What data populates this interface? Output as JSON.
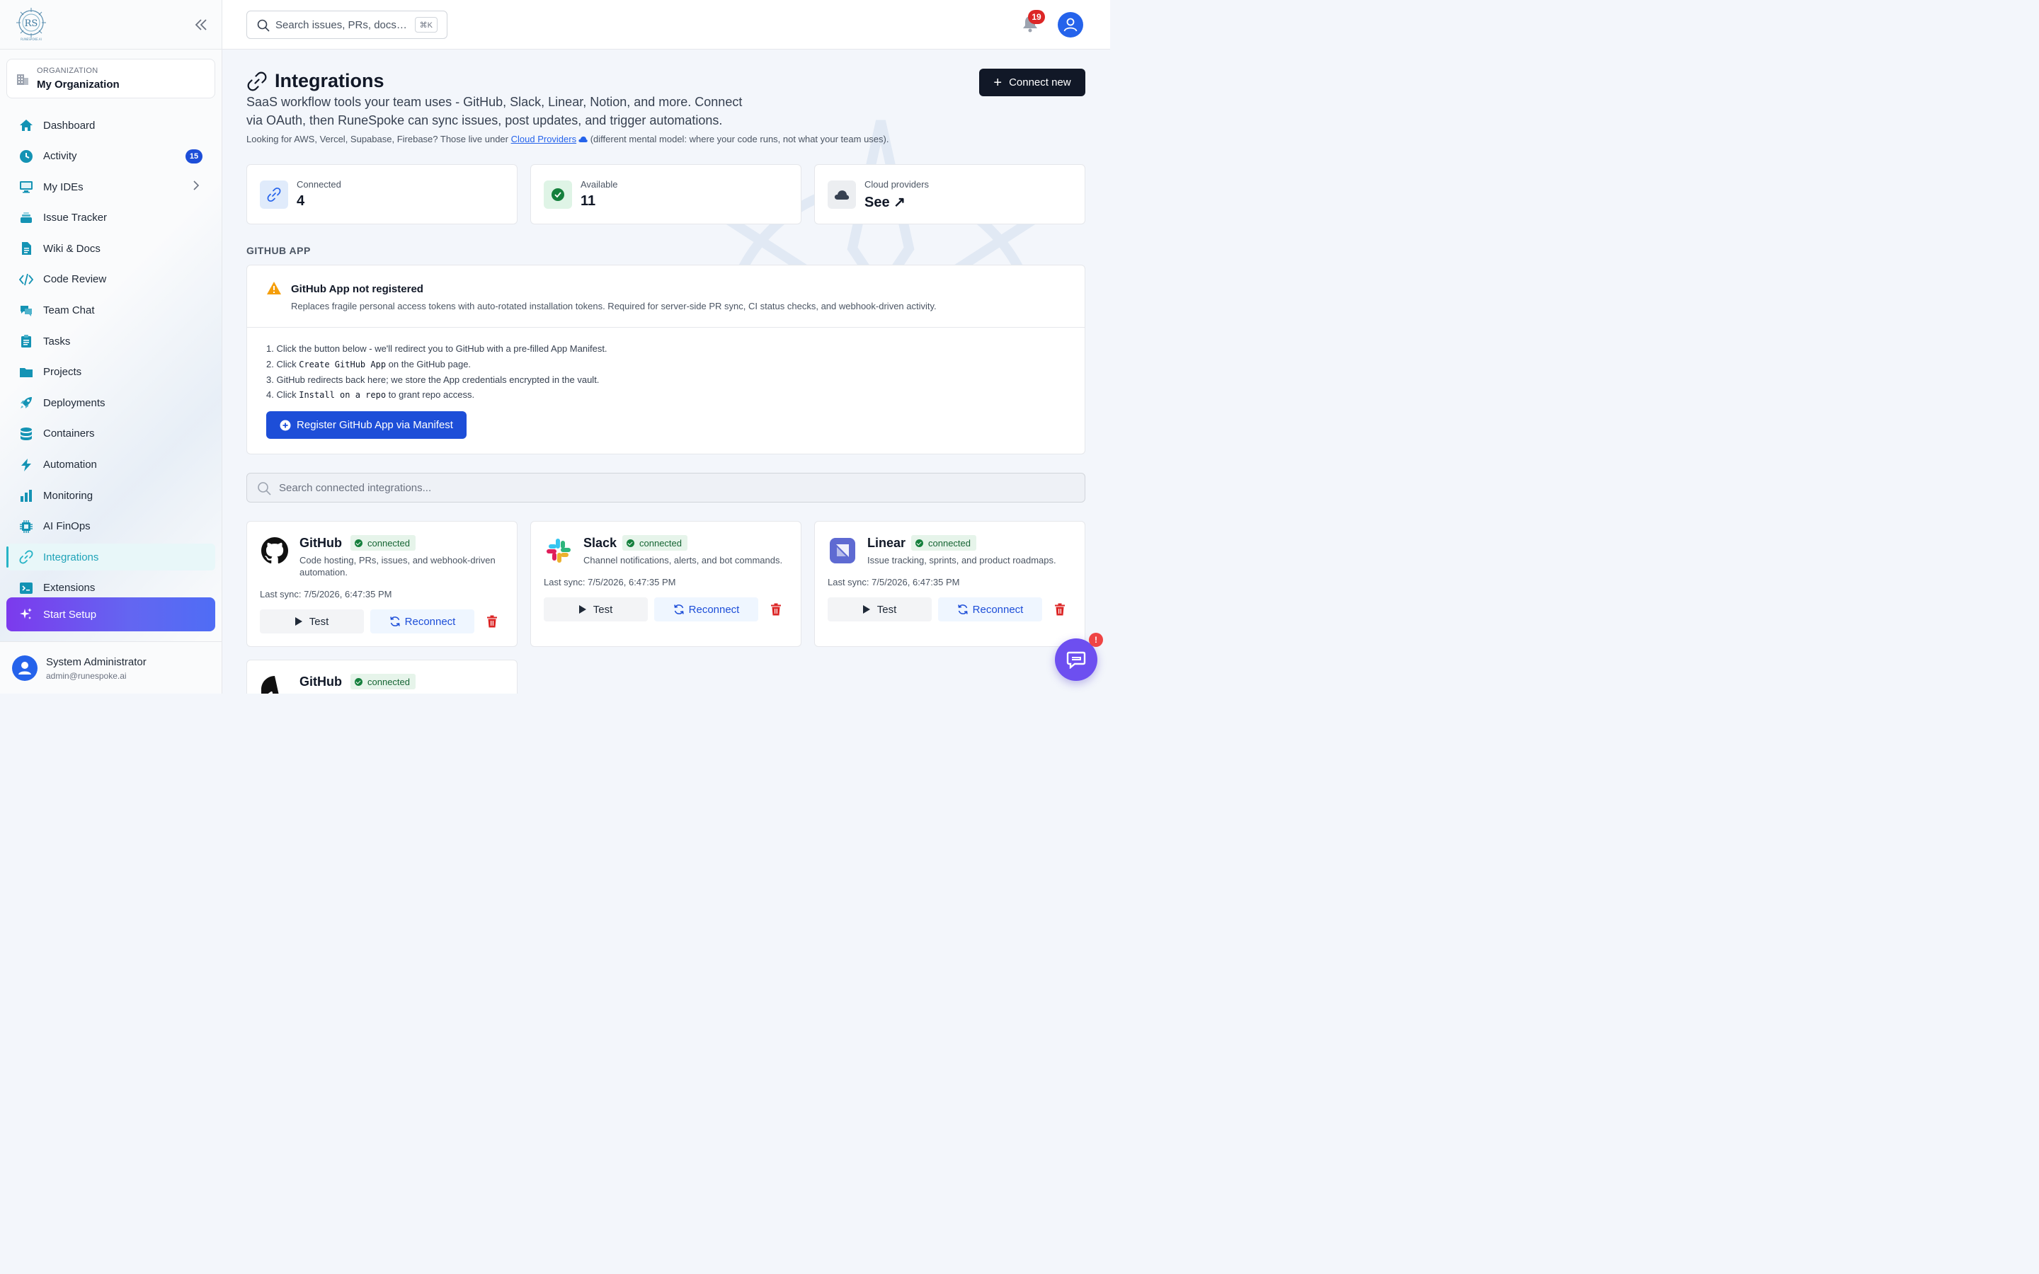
{
  "sidebar": {
    "logo_text": "RUNESPOKE.AI",
    "org_label": "ORGANIZATION",
    "org_name": "My Organization",
    "items": [
      {
        "label": "Dashboard",
        "icon": "home-icon"
      },
      {
        "label": "Activity",
        "icon": "clock-icon",
        "badge": "15"
      },
      {
        "label": "My IDEs",
        "icon": "monitor-icon"
      },
      {
        "label": "Issue Tracker",
        "icon": "layers-icon"
      },
      {
        "label": "Wiki & Docs",
        "icon": "document-icon"
      },
      {
        "label": "Code Review",
        "icon": "code-icon"
      },
      {
        "label": "Team Chat",
        "icon": "chat-icon"
      },
      {
        "label": "Tasks",
        "icon": "clipboard-icon"
      },
      {
        "label": "Projects",
        "icon": "folder-icon"
      },
      {
        "label": "Deployments",
        "icon": "rocket-icon"
      },
      {
        "label": "Containers",
        "icon": "database-icon"
      },
      {
        "label": "Automation",
        "icon": "bolt-icon"
      },
      {
        "label": "Monitoring",
        "icon": "bar-chart-icon"
      },
      {
        "label": "AI FinOps",
        "icon": "chip-icon"
      },
      {
        "label": "Integrations",
        "icon": "link-icon"
      },
      {
        "label": "Extensions",
        "icon": "terminal-icon"
      }
    ],
    "setup_label": "Start Setup",
    "user_name": "System Administrator",
    "user_email": "admin@runespoke.ai"
  },
  "topbar": {
    "search_placeholder": "Search issues, PRs, docs…",
    "shortcut": "⌘K",
    "notification_count": "19"
  },
  "page": {
    "title": "Integrations",
    "description": "SaaS workflow tools your team uses - GitHub, Slack, Linear, Notion, and more. Connect via OAuth, then RuneSpoke can sync issues, post updates, and trigger automations.",
    "note_before": "Looking for AWS, Vercel, Supabase, Firebase? Those live under ",
    "note_link": "Cloud Providers",
    "note_after": " (different mental model: where your code runs, not what your team uses).",
    "connect_label": "Connect new"
  },
  "stats": [
    {
      "label": "Connected",
      "value": "4"
    },
    {
      "label": "Available",
      "value": "11"
    },
    {
      "label": "Cloud providers",
      "value": "See ↗"
    }
  ],
  "github_app": {
    "section": "GITHUB APP",
    "title": "GitHub App not registered",
    "subtitle": "Replaces fragile personal access tokens with auto-rotated installation tokens. Required for server-side PR sync, CI status checks, and webhook-driven activity.",
    "step1": "1. Click the button below - we'll redirect you to GitHub with a pre-filled App Manifest.",
    "step2_pre": "2. Click ",
    "step2_code": "Create GitHub App",
    "step2_post": " on the GitHub page.",
    "step3": "3. GitHub redirects back here; we store the App credentials encrypted in the vault.",
    "step4_pre": "4. Click ",
    "step4_code": "Install on a repo",
    "step4_post": " to grant repo access.",
    "button": "Register GitHub App via Manifest"
  },
  "integrations_search": "Search connected integrations...",
  "cards": [
    {
      "name": "GitHub",
      "status": "connected",
      "desc": "Code hosting, PRs, issues, and webhook-driven automation.",
      "sync": "Last sync: 7/5/2026, 6:47:35 PM",
      "test": "Test",
      "reconnect": "Reconnect"
    },
    {
      "name": "Slack",
      "status": "connected",
      "desc": "Channel notifications, alerts, and bot commands.",
      "sync": "Last sync: 7/5/2026, 6:47:35 PM",
      "test": "Test",
      "reconnect": "Reconnect"
    },
    {
      "name": "Linear",
      "status": "connected",
      "desc": "Issue tracking, sprints, and product roadmaps.",
      "sync": "Last sync: 7/5/2026, 6:47:35 PM",
      "test": "Test",
      "reconnect": "Reconnect"
    },
    {
      "name": "GitHub",
      "status": "connected"
    }
  ],
  "chat_badge": "!"
}
